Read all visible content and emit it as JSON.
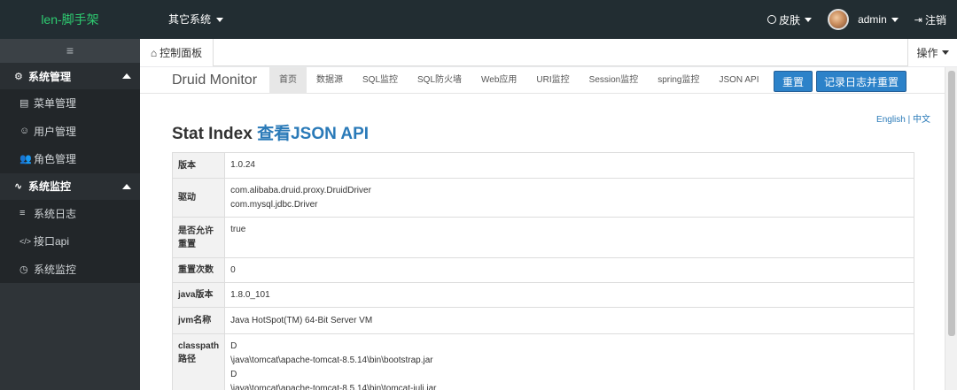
{
  "header": {
    "brand": "len-脚手架",
    "other_systems": "其它系统",
    "skin": "皮肤",
    "user": "admin",
    "logout": "注销"
  },
  "sidebar": {
    "collapse_icon": "≡",
    "groups": [
      {
        "label": "系统管理",
        "icon": "gear-icon",
        "items": [
          {
            "label": "菜单管理",
            "icon": "menu-icon"
          },
          {
            "label": "用户管理",
            "icon": "smile-icon"
          },
          {
            "label": "角色管理",
            "icon": "users-icon"
          }
        ]
      },
      {
        "label": "系统监控",
        "icon": "pulse-icon",
        "items": [
          {
            "label": "系统日志",
            "icon": "file-icon"
          },
          {
            "label": "接口api",
            "icon": "code-icon"
          },
          {
            "label": "系统监控",
            "icon": "clock-icon"
          }
        ]
      }
    ]
  },
  "tabs": {
    "active": "控制面板",
    "operations": "操作"
  },
  "druid": {
    "brand": "Druid Monitor",
    "nav": [
      "首页",
      "数据源",
      "SQL监控",
      "SQL防火墙",
      "Web应用",
      "URI监控",
      "Session监控",
      "spring监控",
      "JSON API"
    ],
    "reset": "重置",
    "log_reset": "记录日志并重置",
    "lang_en": "English",
    "lang_sep": " | ",
    "lang_zh": "中文",
    "title": "Stat Index ",
    "title_link": "查看JSON API",
    "rows": [
      {
        "key": "版本",
        "value": [
          "1.0.24"
        ]
      },
      {
        "key": "驱动",
        "value": [
          "com.alibaba.druid.proxy.DruidDriver",
          "com.mysql.jdbc.Driver"
        ]
      },
      {
        "key": "是否允许重置",
        "value": [
          "true"
        ]
      },
      {
        "key": "重置次数",
        "value": [
          "0"
        ]
      },
      {
        "key": "java版本",
        "value": [
          "1.8.0_101"
        ]
      },
      {
        "key": "jvm名称",
        "value": [
          "Java HotSpot(TM) 64-Bit Server VM"
        ]
      },
      {
        "key": "classpath路径",
        "value": [
          "D",
          "\\java\\tomcat\\apache-tomcat-8.5.14\\bin\\bootstrap.jar",
          "D",
          "\\java\\tomcat\\apache-tomcat-8.5.14\\bin\\tomcat-juli.jar"
        ]
      }
    ]
  }
}
